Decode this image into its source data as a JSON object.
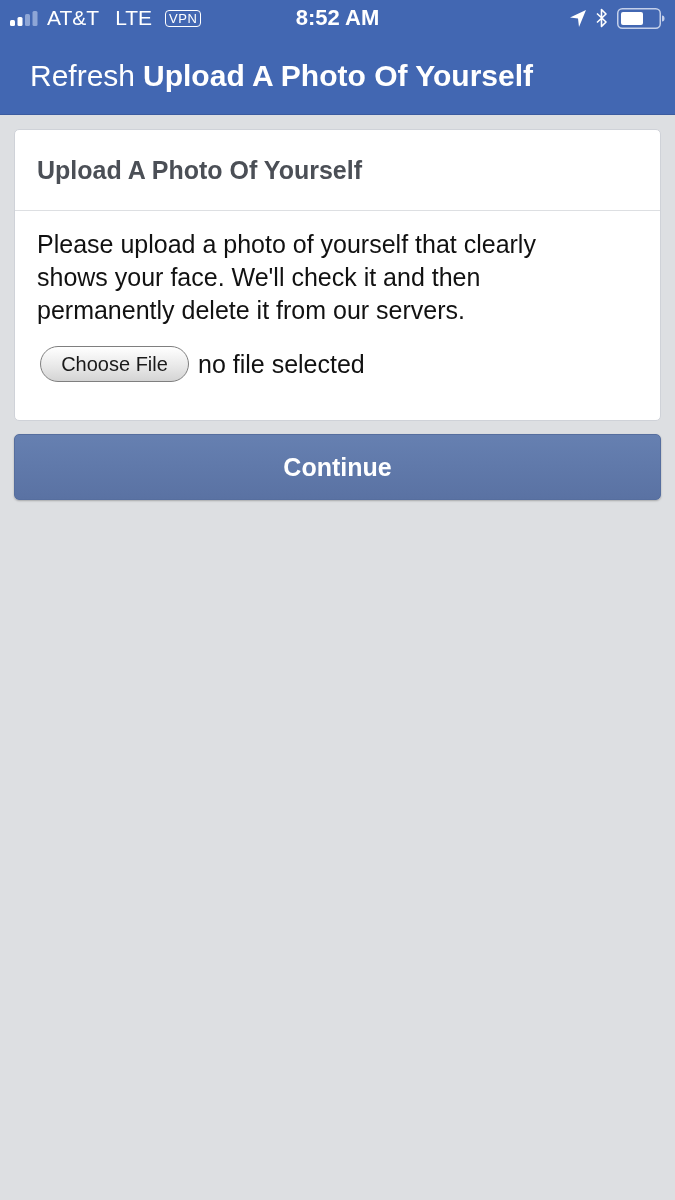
{
  "status_bar": {
    "carrier": "AT&T",
    "network": "LTE",
    "vpn": "VPN",
    "time": "8:52 AM"
  },
  "header": {
    "refresh_link": "Refresh",
    "title": "Upload A Photo Of Yourself"
  },
  "card": {
    "title": "Upload A Photo Of Yourself",
    "message": "Please upload a photo of yourself that clearly shows your face. We'll check it and then permanently delete it from our servers.",
    "file_input": {
      "button": "Choose File",
      "status": "no file selected"
    }
  },
  "continue_button": "Continue"
}
